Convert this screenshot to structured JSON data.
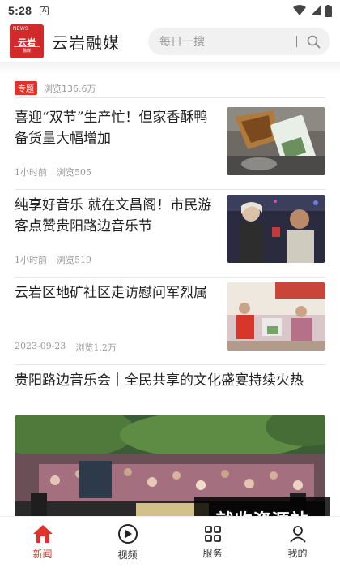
{
  "status": {
    "time": "5:28",
    "notif": "A"
  },
  "header": {
    "logo": {
      "top": "NEWS",
      "main": "云岩",
      "sub": "融媒"
    },
    "app_name": "云岩融媒",
    "search_placeholder": "每日一搜"
  },
  "special": {
    "tag": "专题",
    "views": "浏览136.6万"
  },
  "articles": [
    {
      "title": "喜迎“双节”生产忙！但家香酥鸭备货量大幅增加",
      "time": "1小时前",
      "views": "浏览505",
      "thumb": "food-packaging-photo"
    },
    {
      "title": "纯享好音乐 就在文昌阁！市民游客点赞贵阳路边音乐节",
      "time": "1小时前",
      "views": "浏览519",
      "thumb": "street-music-performers-photo"
    },
    {
      "title": "云岩区地矿社区走访慰问军烈属",
      "time": "2023-09-23",
      "views": "浏览1.2万",
      "thumb": "community-visit-photo"
    },
    {
      "title": "贵阳路边音乐会｜全民共享的文化盛宴持续火热",
      "image": "outdoor-concert-crowd-photo"
    }
  ],
  "watermark": "就收资源站",
  "nav": [
    {
      "label": "新闻",
      "icon": "home-icon",
      "active": true
    },
    {
      "label": "视频",
      "icon": "play-icon",
      "active": false
    },
    {
      "label": "服务",
      "icon": "grid-icon",
      "active": false
    },
    {
      "label": "我的",
      "icon": "user-icon",
      "active": false
    }
  ],
  "colors": {
    "accent": "#e0322a",
    "logo_bg": "#d22a2a"
  }
}
